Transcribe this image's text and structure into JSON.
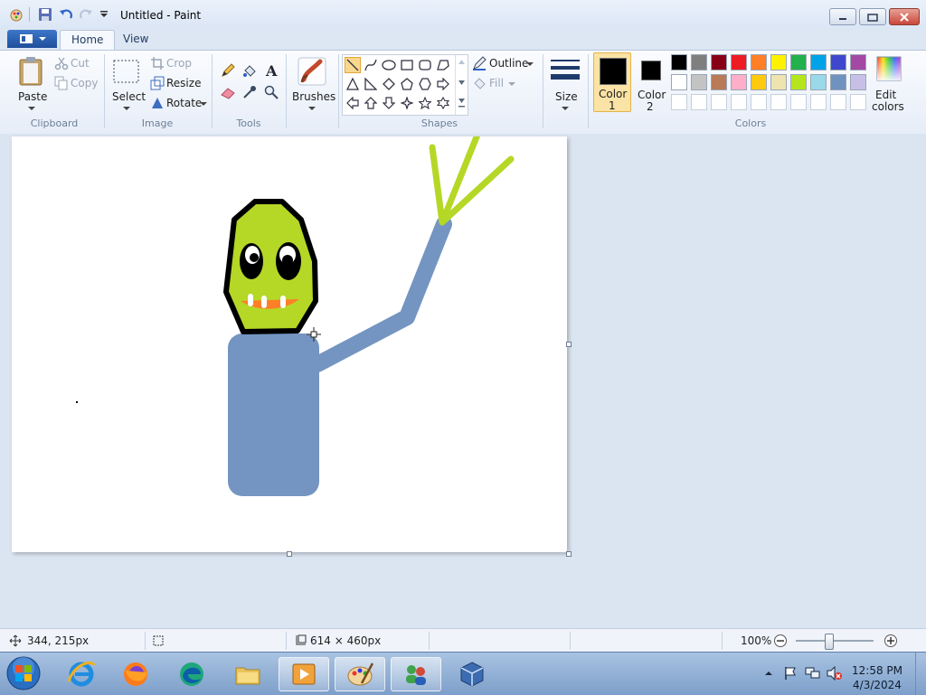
{
  "window": {
    "title": "Untitled - Paint"
  },
  "tabs": [
    {
      "label": "Home"
    },
    {
      "label": "View"
    }
  ],
  "clipboard": {
    "paste": "Paste",
    "cut": "Cut",
    "copy": "Copy",
    "group": "Clipboard"
  },
  "image": {
    "select": "Select",
    "crop": "Crop",
    "resize": "Resize",
    "rotate": "Rotate",
    "group": "Image"
  },
  "tools": {
    "group": "Tools",
    "brushes": "Brushes"
  },
  "shapes": {
    "outline": "Outline",
    "fill": "Fill",
    "group": "Shapes"
  },
  "size": {
    "label": "Size"
  },
  "colors": {
    "color1": "Color",
    "color1_num": "1",
    "color2": "Color",
    "color2_num": "2",
    "edit_a": "Edit",
    "edit_b": "colors",
    "group": "Colors",
    "palette_row1": [
      "#000000",
      "#7f7f7f",
      "#880015",
      "#ed1c24",
      "#ff7f27",
      "#fff200",
      "#22b14c",
      "#00a2e8",
      "#3f48cc",
      "#a349a4"
    ],
    "palette_row2": [
      "#ffffff",
      "#c3c3c3",
      "#b97a57",
      "#ffaec9",
      "#ffc90e",
      "#efe4b0",
      "#b5e61d",
      "#99d9ea",
      "#7092be",
      "#c8bfe7"
    ],
    "primary": "#000000",
    "secondary": "#000000"
  },
  "status": {
    "cursor_pos": "344, 215px",
    "canvas_size": "614 × 460px",
    "zoom": "100%",
    "zoom_fraction": 0.42
  },
  "taskbar": {
    "apps": [
      "start-orb",
      "internet-explorer",
      "firefox",
      "edge",
      "file-explorer",
      "media-player",
      "paint",
      "network-tool",
      "virtualbox"
    ],
    "time": "12:58 PM",
    "date": "4/3/2024"
  }
}
